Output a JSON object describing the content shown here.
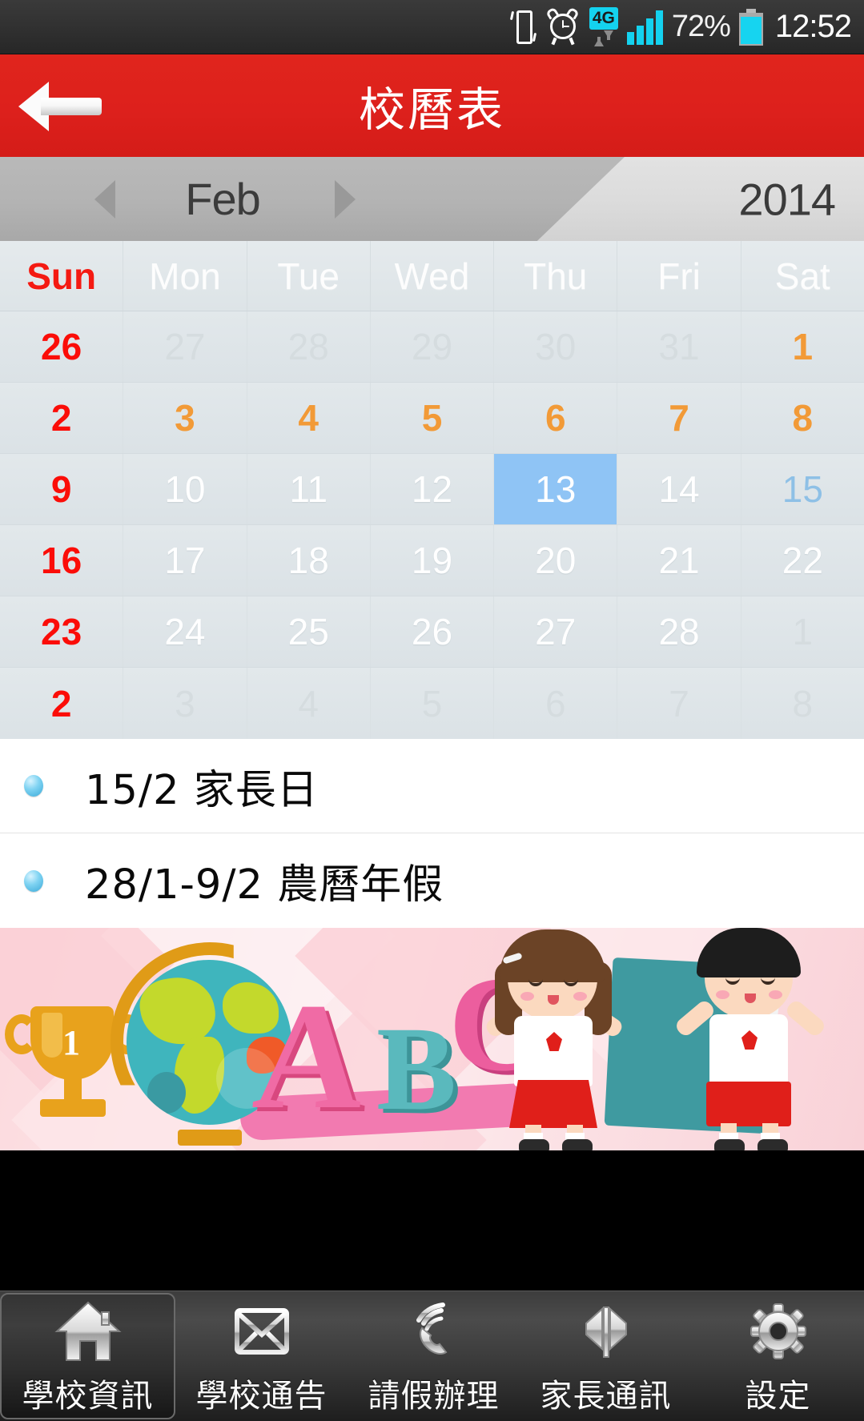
{
  "statusbar": {
    "battery_percent": "72%",
    "clock": "12:52",
    "network_label": "4G",
    "icons": [
      "vibrate-icon",
      "alarm-icon",
      "network-4g-icon",
      "signal-bars-icon",
      "battery-icon"
    ]
  },
  "titlebar": {
    "back_icon": "back-arrow-icon",
    "title": "校曆表",
    "bg_color": "#dd201c"
  },
  "monthbar": {
    "prev_icon": "chevron-left-icon",
    "month": "Feb",
    "next_icon": "chevron-right-icon",
    "year": "2014"
  },
  "calendar": {
    "weekdays": [
      "Sun",
      "Mon",
      "Tue",
      "Wed",
      "Thu",
      "Fri",
      "Sat"
    ],
    "colors": {
      "sunday": "#fb0d08",
      "holiday": "#f29a37",
      "event": "#8ec0e6",
      "selected_bg": "#8fc4f5",
      "other_month": "#d5dcdf",
      "normal": "#ffffff",
      "cell_bg": "#dfe5e8"
    },
    "rows": [
      [
        {
          "d": "26",
          "type": "other sun"
        },
        {
          "d": "27",
          "type": "other"
        },
        {
          "d": "28",
          "type": "other"
        },
        {
          "d": "29",
          "type": "other"
        },
        {
          "d": "30",
          "type": "other"
        },
        {
          "d": "31",
          "type": "other"
        },
        {
          "d": "1",
          "type": "holiday"
        }
      ],
      [
        {
          "d": "2",
          "type": "sun"
        },
        {
          "d": "3",
          "type": "holiday"
        },
        {
          "d": "4",
          "type": "holiday"
        },
        {
          "d": "5",
          "type": "holiday"
        },
        {
          "d": "6",
          "type": "holiday"
        },
        {
          "d": "7",
          "type": "holiday"
        },
        {
          "d": "8",
          "type": "holiday"
        }
      ],
      [
        {
          "d": "9",
          "type": "sun"
        },
        {
          "d": "10",
          "type": "normal"
        },
        {
          "d": "11",
          "type": "normal"
        },
        {
          "d": "12",
          "type": "normal"
        },
        {
          "d": "13",
          "type": "selected"
        },
        {
          "d": "14",
          "type": "normal"
        },
        {
          "d": "15",
          "type": "event"
        }
      ],
      [
        {
          "d": "16",
          "type": "sun"
        },
        {
          "d": "17",
          "type": "normal"
        },
        {
          "d": "18",
          "type": "normal"
        },
        {
          "d": "19",
          "type": "normal"
        },
        {
          "d": "20",
          "type": "normal"
        },
        {
          "d": "21",
          "type": "normal"
        },
        {
          "d": "22",
          "type": "normal"
        }
      ],
      [
        {
          "d": "23",
          "type": "sun"
        },
        {
          "d": "24",
          "type": "normal"
        },
        {
          "d": "25",
          "type": "normal"
        },
        {
          "d": "26",
          "type": "normal"
        },
        {
          "d": "27",
          "type": "normal"
        },
        {
          "d": "28",
          "type": "normal"
        },
        {
          "d": "1",
          "type": "other"
        }
      ],
      [
        {
          "d": "2",
          "type": "other sun"
        },
        {
          "d": "3",
          "type": "other"
        },
        {
          "d": "4",
          "type": "other"
        },
        {
          "d": "5",
          "type": "other"
        },
        {
          "d": "6",
          "type": "other"
        },
        {
          "d": "7",
          "type": "other"
        },
        {
          "d": "8",
          "type": "other"
        }
      ]
    ]
  },
  "events": [
    {
      "bullet": "blue-dot-icon",
      "text": "15/2 家長日"
    },
    {
      "bullet": "blue-dot-icon",
      "text": "28/1-9/2 農曆年假"
    }
  ],
  "banner": {
    "alt": "school-children-banner",
    "letters": [
      "A",
      "B",
      "C"
    ],
    "trophy_number": "1"
  },
  "bottomnav": {
    "items": [
      {
        "icon": "home-icon",
        "label": "學校資訊",
        "active": true
      },
      {
        "icon": "envelope-icon",
        "label": "學校通告",
        "active": false
      },
      {
        "icon": "phone-call-icon",
        "label": "請假辦理",
        "active": false
      },
      {
        "icon": "megaphone-icon",
        "label": "家長通訊",
        "active": false
      },
      {
        "icon": "gear-icon",
        "label": "設定",
        "active": false
      }
    ]
  }
}
